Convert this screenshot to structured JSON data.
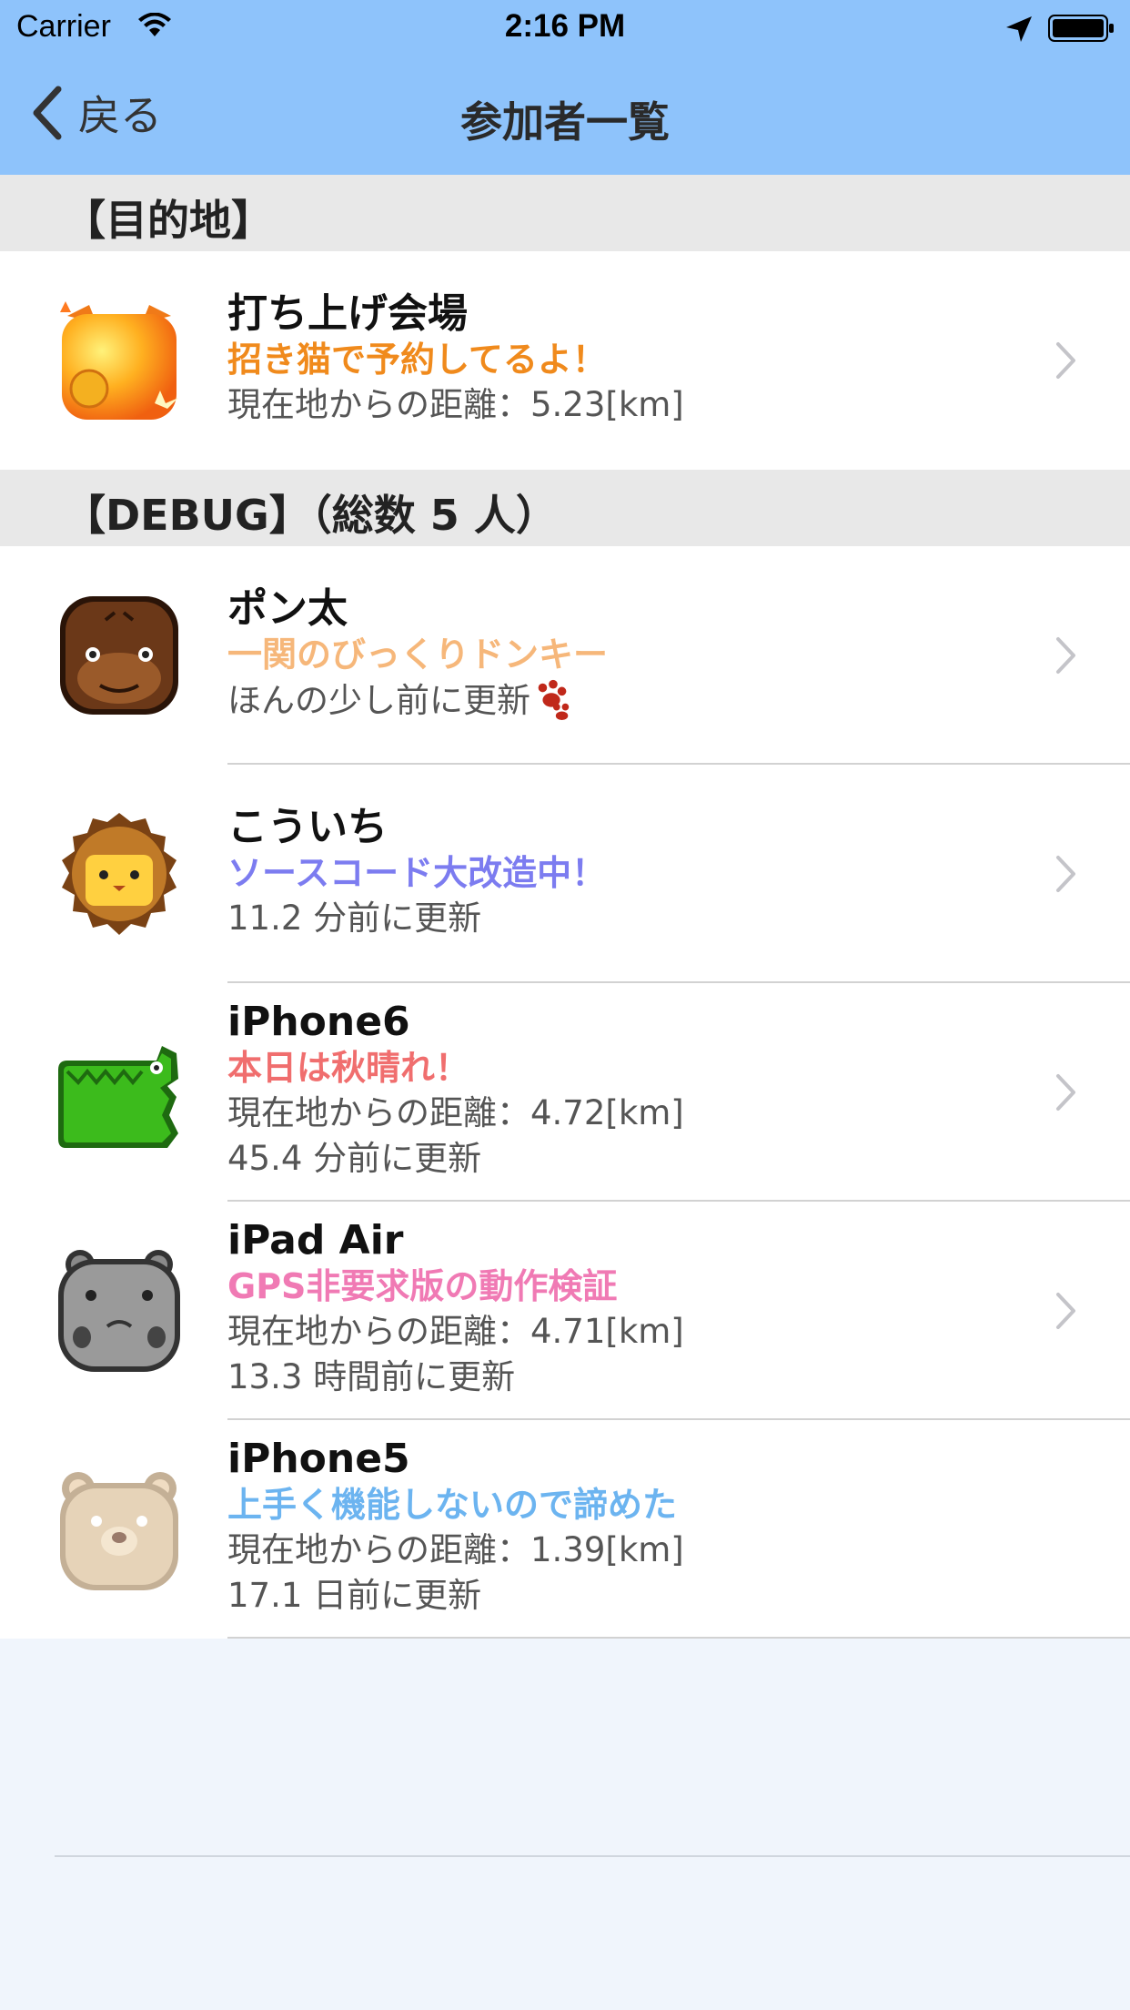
{
  "status_bar": {
    "carrier": "Carrier",
    "time": "2:16 PM"
  },
  "nav": {
    "back_label": "戻る",
    "title": "参加者一覧"
  },
  "sections": [
    {
      "header": "【目的地】"
    },
    {
      "header": "【DEBUG】（総数 5 人）"
    }
  ],
  "destination": {
    "name": "打ち上げ会場",
    "message": "招き猫で予約してるよ！",
    "lines": [
      "現在地からの距離：5.23[km]"
    ],
    "message_color": "#f08a1c",
    "avatar": "maneki-neko-icon"
  },
  "participants": [
    {
      "name": "ポン太",
      "message": "一関のびっくりドンキー",
      "message_color": "#f6b77a",
      "lines": [
        "ほんの少し前に更新"
      ],
      "extra_icon": "paw-icon",
      "avatar": "gorilla-icon"
    },
    {
      "name": "こういち",
      "message": "ソースコード大改造中！",
      "message_color": "#7c7cf0",
      "lines": [
        "11.2 分前に更新"
      ],
      "avatar": "lion-icon"
    },
    {
      "name": "iPhone6",
      "message": "本日は秋晴れ！",
      "message_color": "#f06e6e",
      "lines": [
        "現在地からの距離：4.72[km]",
        "45.4 分前に更新"
      ],
      "avatar": "crocodile-icon"
    },
    {
      "name": "iPad Air",
      "message": "GPS非要求版の動作検証",
      "message_color": "#f07ab4",
      "lines": [
        "現在地からの距離：4.71[km]",
        "13.3 時間前に更新"
      ],
      "avatar": "hippo-icon"
    },
    {
      "name": "iPhone5",
      "message": "上手く機能しないので諦めた",
      "message_color": "#6cb4f0",
      "lines": [
        "現在地からの距離：1.39[km]",
        "17.1 日前に更新"
      ],
      "avatar": "bear-icon"
    }
  ],
  "colors": {
    "nav_bar": "#8ec3fb",
    "section_bg": "#e8e8e8",
    "page_bg": "#f0f5fc"
  }
}
